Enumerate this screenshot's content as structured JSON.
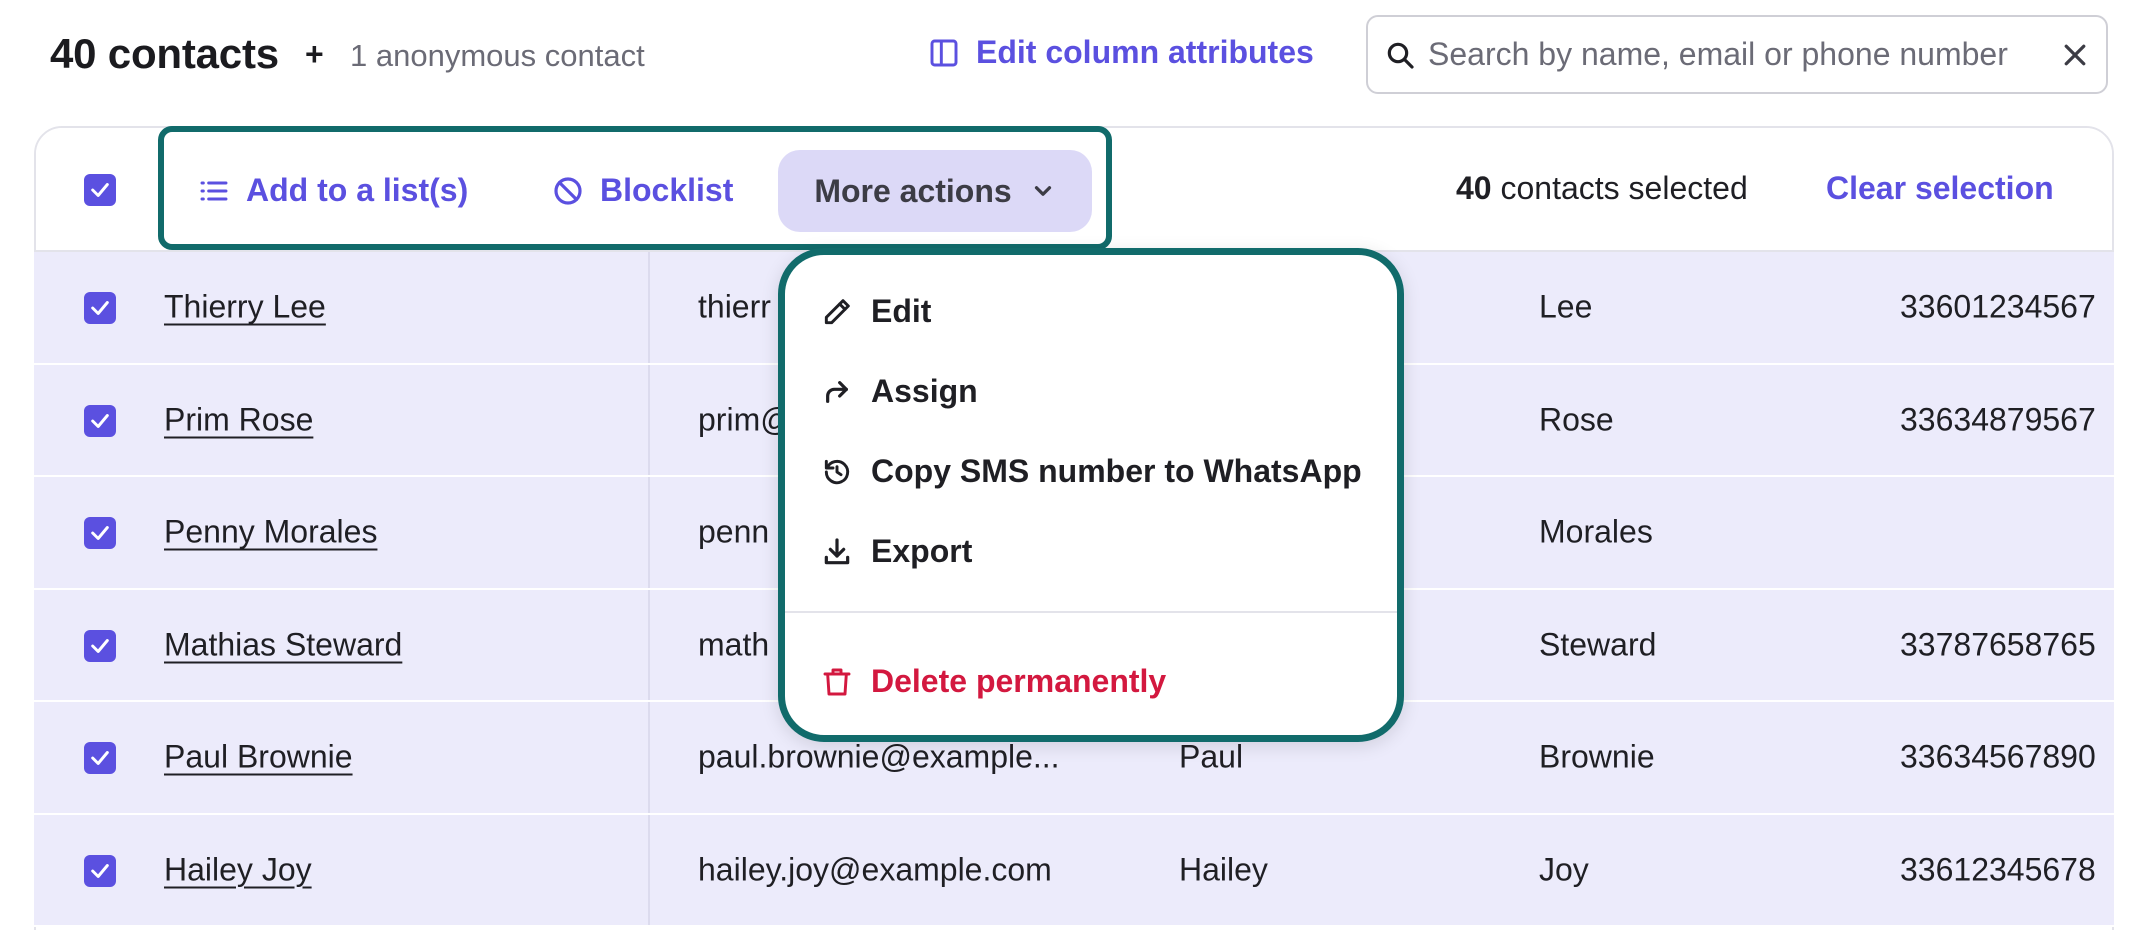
{
  "header": {
    "contacts_count": "40 contacts",
    "plus": "+",
    "anonymous": "1 anonymous contact",
    "edit_columns_label": "Edit column attributes"
  },
  "search": {
    "placeholder": "Search by name, email or phone number",
    "value": ""
  },
  "actions": {
    "add_to_list_label": "Add to a list(s)",
    "blocklist_label": "Blocklist",
    "more_actions_label": "More actions",
    "selected_count": "40",
    "selected_suffix": "contacts selected",
    "clear_selection_label": "Clear selection"
  },
  "menu": {
    "edit": "Edit",
    "assign": "Assign",
    "copy_sms": "Copy SMS number to WhatsApp",
    "export": "Export",
    "delete": "Delete permanently"
  },
  "rows": [
    {
      "name": "Thierry Lee",
      "email": "thierr",
      "first": "",
      "last": "Lee",
      "phone": "33601234567"
    },
    {
      "name": "Prim Rose",
      "email": "prim@",
      "first": "",
      "last": "Rose",
      "phone": "33634879567"
    },
    {
      "name": "Penny Morales",
      "email": "penn",
      "first": "",
      "last": "Morales",
      "phone": ""
    },
    {
      "name": "Mathias Steward",
      "email": "math",
      "first": "",
      "last": "Steward",
      "phone": "33787658765"
    },
    {
      "name": "Paul Brownie",
      "email": "paul.brownie@example...",
      "first": "Paul",
      "last": "Brownie",
      "phone": "33634567890"
    },
    {
      "name": "Hailey Joy",
      "email": "hailey.joy@example.com",
      "first": "Hailey",
      "last": "Joy",
      "phone": "33612345678"
    }
  ],
  "colors": {
    "accent": "#5b50e0",
    "highlight": "#116b6b",
    "danger": "#d3183f",
    "row_bg": "#ecebfb"
  }
}
